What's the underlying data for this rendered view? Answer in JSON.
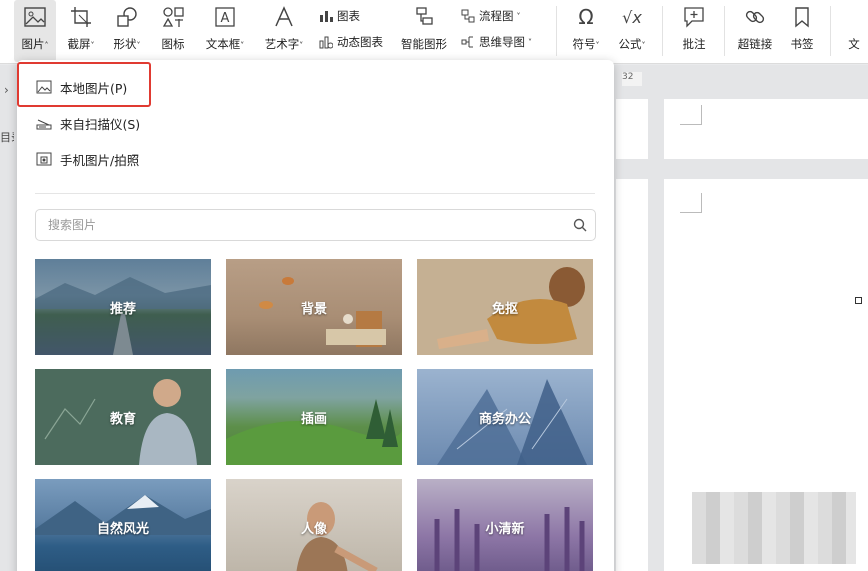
{
  "ribbon": {
    "picture": "图片",
    "screenshot": "截屏",
    "shape": "形状",
    "icon": "图标",
    "textbox": "文本框",
    "wordart": "艺术字",
    "chart": "图表",
    "dynamic_chart": "动态图表",
    "smart_shape": "智能图形",
    "flowchart": "流程图",
    "mindmap": "思维导图",
    "symbol": "符号",
    "formula": "公式",
    "comment": "批注",
    "hyperlink": "超链接",
    "bookmark": "书签",
    "cut_text": "文"
  },
  "ruler": {
    "number": "32"
  },
  "sidebar": {
    "cut_label": "目录"
  },
  "picture_menu": {
    "items": [
      {
        "label": "本地图片(P)",
        "icon": "local-image-icon"
      },
      {
        "label": "来自扫描仪(S)",
        "icon": "scanner-icon"
      },
      {
        "label": "手机图片/拍照",
        "icon": "phone-photo-icon"
      }
    ],
    "search_placeholder": "搜索图片",
    "categories": [
      {
        "label": "推荐"
      },
      {
        "label": "背景"
      },
      {
        "label": "免抠"
      },
      {
        "label": "教育"
      },
      {
        "label": "插画"
      },
      {
        "label": "商务办公"
      },
      {
        "label": "自然风光"
      },
      {
        "label": "人像"
      },
      {
        "label": "小清新"
      }
    ]
  },
  "colors": {
    "highlight": "#e03a31"
  }
}
